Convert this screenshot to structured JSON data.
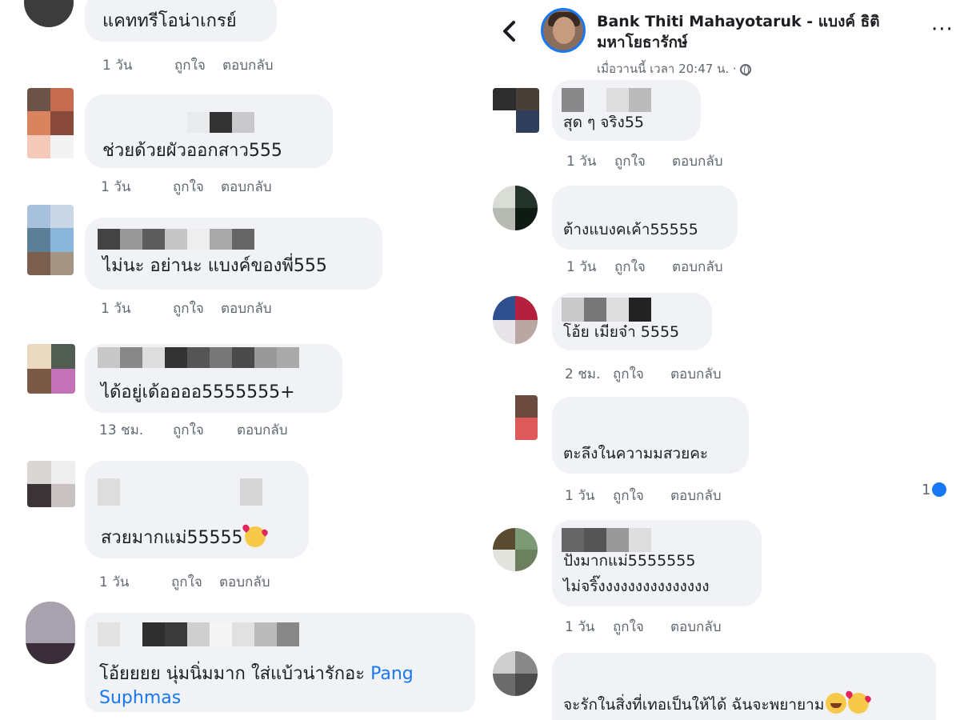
{
  "header": {
    "page_name": "Bank Thiti Mahayotaruk - แบงค์ ธิติ มหาโยธารักษ์",
    "post_time": "เมื่อวานนี้ เวลา 20:47 น. ·",
    "more_icon": "more-horizontal-icon",
    "back_icon": "chevron-left-icon",
    "visibility_icon": "globe-icon"
  },
  "actions": {
    "like": "ถูกใจ",
    "reply": "ตอบกลับ"
  },
  "left_comments": [
    {
      "text": "แคททรีโอน่าเกรย์",
      "time": "1 วัน"
    },
    {
      "text": "ช่วยด้วยผัวออกสาว555",
      "time": "1 วัน"
    },
    {
      "text": "ไม่นะ  อย่านะ แบงค์ของพี่555",
      "time": "1 วัน"
    },
    {
      "text": "ได้อยู่เด้ออออ5555555+",
      "time": "13 ชม."
    },
    {
      "text": "สวยมากแม่55555",
      "emoji": "smiling-face-with-hearts-icon",
      "time": "1 วัน"
    },
    {
      "text": "โอ้ยยยย นุ่มนิ่มมาก ใส่แบ้วน่ารักอะ ",
      "mention": "Pang Suphmas"
    }
  ],
  "right_comments": [
    {
      "text": "สุด ๆ จริง55",
      "time": "1 วัน"
    },
    {
      "text": "ต้างแบงคเค้า55555",
      "time": "1 วัน"
    },
    {
      "text": "โอ้ย เมียจ๋า 5555",
      "time": "2 ชม."
    },
    {
      "text": "ตะลึงในความมสวยคะ",
      "time": "1 วัน",
      "reaction_count": "1"
    },
    {
      "text_line1": "ปังมากแม่5555555",
      "text_line2": "ไม่จริ๊งงงงงงงงงงงงงงง",
      "time": "1 วัน"
    },
    {
      "text": "จะรักในสิ่งที่เทอเป็นให้ได้ ฉันจะพยายาม",
      "emojis": [
        "rolling-laughing-icon",
        "smiling-face-with-hearts-icon"
      ]
    }
  ]
}
